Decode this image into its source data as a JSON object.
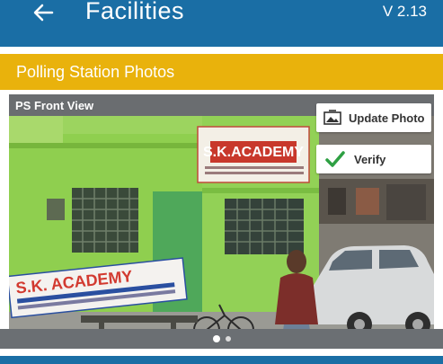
{
  "header": {
    "title": "Facilities",
    "version": "V 2.13",
    "back_icon": "arrow-left-icon"
  },
  "section": {
    "title": "Polling Station Photos"
  },
  "gallery": {
    "caption": "PS Front View",
    "update_label": "Update Photo",
    "verify_label": "Verify",
    "photo": {
      "sign_main": "S.K.ACADEMY",
      "sign_banner": "S.K. ACADEMY"
    },
    "pager": {
      "total": 2,
      "active": 1
    }
  },
  "colors": {
    "app_bar": "#1a6ea5",
    "section_header": "#e9b20c",
    "caption_bar": "#6a6d70",
    "verify_check": "#2ea043"
  }
}
